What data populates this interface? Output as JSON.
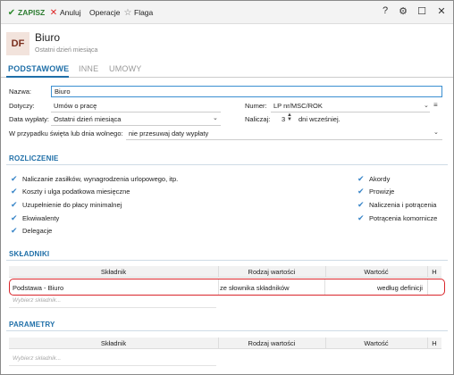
{
  "toolbar": {
    "save_label": "ZAPISZ",
    "cancel_label": "Anuluj",
    "operations_label": "Operacje",
    "flag_label": "Flaga",
    "help": "?",
    "settings": "⚙",
    "minimize": "☐",
    "close": "✕"
  },
  "header": {
    "avatar": "DF",
    "title": "Biuro",
    "subtitle": "Ostatni dzień miesiąca"
  },
  "tabs": [
    "PODSTAWOWE",
    "INNE",
    "UMOWY"
  ],
  "form": {
    "nazwa_label": "Nazwa:",
    "nazwa_value": "Biuro",
    "dotyczy_label": "Dotyczy:",
    "dotyczy_value": "Umów o pracę",
    "numer_label": "Numer:",
    "numer_value": "LP nr/MSC/ROK",
    "data_wyplaty_label": "Data wypłaty:",
    "data_wyplaty_value": "Ostatni dzień miesiąca",
    "naliczaj_label": "Naliczaj:",
    "naliczaj_value": "3",
    "naliczaj_suffix": "dni wcześniej.",
    "swieto_label": "W przypadku święta lub dnia wolnego:",
    "swieto_value": "nie przesuwaj daty wypłaty"
  },
  "rozliczenie": {
    "title": "ROZLICZENIE",
    "left": [
      "Naliczanie zasiłków, wynagrodzenia urlopowego, itp.",
      "Koszty i ulga podatkowa miesięczne",
      "Uzupełnienie do płacy minimalnej",
      "Ekwiwalenty",
      "Delegacje"
    ],
    "right": [
      "Akordy",
      "Prowizje",
      "Naliczenia i potrącenia",
      "Potrącenia komornicze"
    ]
  },
  "skladniki": {
    "title": "SKŁADNIKI",
    "columns": [
      "Składnik",
      "Rodzaj wartości",
      "Wartość",
      "H"
    ],
    "rows": [
      {
        "skladnik": "Podstawa - Biuro",
        "rodzaj": "ze słownika składników",
        "wartosc": "według definicji"
      }
    ],
    "placeholder": "Wybierz składnik..."
  },
  "parametry": {
    "title": "PARAMETRY",
    "columns": [
      "Składnik",
      "Rodzaj wartości",
      "Wartość",
      "H"
    ],
    "placeholder": "Wybierz składnik..."
  }
}
